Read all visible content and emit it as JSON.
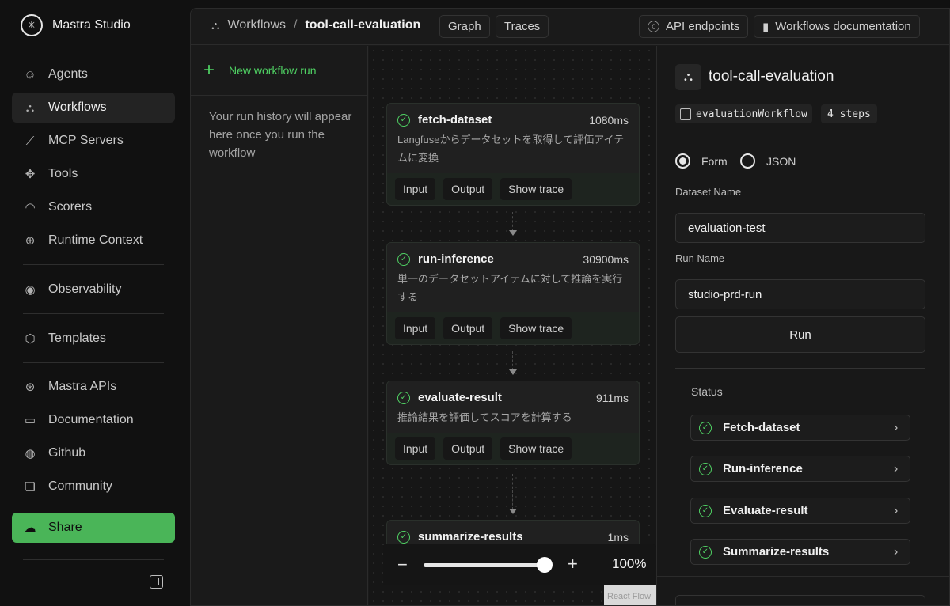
{
  "brand": {
    "name": "Mastra Studio",
    "logo_icon": "mastra-logo-icon"
  },
  "sidebar": {
    "items": [
      {
        "label": "Agents",
        "icon": "agent-icon",
        "glyph": "☺"
      },
      {
        "label": "Workflows",
        "icon": "workflow-icon",
        "glyph": "⛬",
        "active": true
      },
      {
        "label": "MCP Servers",
        "icon": "mcp-icon",
        "glyph": "⟋"
      },
      {
        "label": "Tools",
        "icon": "tools-icon",
        "glyph": "✥"
      },
      {
        "label": "Scorers",
        "icon": "gauge-icon",
        "glyph": "◠"
      },
      {
        "label": "Runtime Context",
        "icon": "globe-icon",
        "glyph": "⊕"
      },
      {
        "label": "Observability",
        "icon": "eye-icon",
        "glyph": "◉"
      },
      {
        "label": "Templates",
        "icon": "cube-icon",
        "glyph": "⬡"
      },
      {
        "label": "Mastra APIs",
        "icon": "api-globe-icon",
        "glyph": "⊛"
      },
      {
        "label": "Documentation",
        "icon": "book-icon",
        "glyph": "▭"
      },
      {
        "label": "Github",
        "icon": "github-icon",
        "glyph": "◍"
      },
      {
        "label": "Community",
        "icon": "chat-icon",
        "glyph": "❏"
      }
    ],
    "share_label": "Share"
  },
  "header": {
    "breadcrumb_root": "Workflows",
    "breadcrumb_sep": "/",
    "breadcrumb_current": "tool-call-evaluation",
    "tabs": [
      "Graph",
      "Traces"
    ],
    "api_endpoints": "API endpoints",
    "docs": "Workflows documentation"
  },
  "history": {
    "new_run": "New workflow run",
    "empty": "Your run history will appear here once you run the workflow"
  },
  "graph": {
    "nodes": [
      {
        "name": "fetch-dataset",
        "time": "1080ms",
        "desc": "Langfuseからデータセットを取得して評価アイテムに変換",
        "status": "success"
      },
      {
        "name": "run-inference",
        "time": "30900ms",
        "desc": "単一のデータセットアイテムに対して推論を実行する",
        "status": "success"
      },
      {
        "name": "evaluate-result",
        "time": "911ms",
        "desc": "推論結果を評価してスコアを計算する",
        "status": "success"
      },
      {
        "name": "summarize-results",
        "time": "1ms",
        "desc": "",
        "status": "success"
      }
    ],
    "actions": [
      "Input",
      "Output",
      "Show trace"
    ],
    "zoom_minus": "−",
    "zoom_plus": "+",
    "zoom_level": "100%",
    "zoom_fraction": 0.9,
    "attribution": "React Flow"
  },
  "details": {
    "title": "tool-call-evaluation",
    "workflow_id": "evaluationWorkflow",
    "steps": "4 steps",
    "mode_form": "Form",
    "mode_json": "JSON",
    "selected_mode": "Form",
    "dataset_label": "Dataset Name",
    "dataset_value": "evaluation-test",
    "run_label": "Run Name",
    "run_value": "studio-prd-run",
    "run_button": "Run",
    "status_label": "Status",
    "status_items": [
      "Fetch-dataset",
      "Run-inference",
      "Evaluate-result",
      "Summarize-results"
    ]
  },
  "colors": {
    "accent": "#4fd163",
    "share": "#4ab558",
    "bg": "#111111",
    "panel": "#1a1a1a"
  }
}
